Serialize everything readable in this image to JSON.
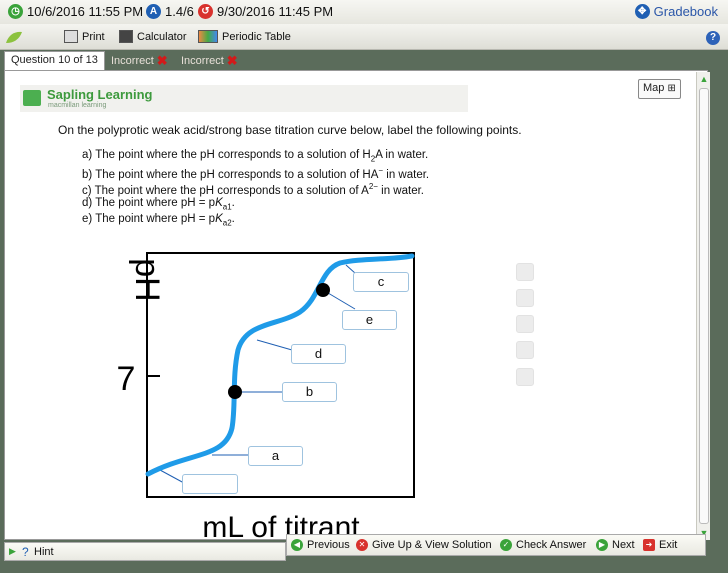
{
  "topbar": {
    "due_date": "10/6/2016 11:55 PM",
    "score": "1.4/6",
    "submitted": "9/30/2016 11:45 PM",
    "gradebook": "Gradebook"
  },
  "toolbar": {
    "print": "Print",
    "calculator": "Calculator",
    "periodic_table": "Periodic Table",
    "help": "?"
  },
  "tabs": {
    "question": "Question 10 of 13",
    "status1": "Incorrect",
    "status2": "Incorrect"
  },
  "map": "Map",
  "logo": {
    "name": "Sapling Learning",
    "tagline": "macmillan learning"
  },
  "question": {
    "prompt": "On the polyprotic weak acid/strong base titration curve below, label the following points.",
    "items": [
      {
        "prefix": "a) The point where the pH corresponds to a solution of H",
        "sub": "2",
        "suffix": "A in water."
      },
      {
        "prefix": "b) The point where the pH corresponds to a solution of HA",
        "sup": "−",
        "suffix": " in water."
      },
      {
        "prefix": "c) The point where the pH corresponds to a solution of A",
        "sup": "2−",
        "suffix": " in water."
      },
      {
        "prefix": "d) The point where pH = p",
        "italic": "K",
        "sub": "a1",
        "suffix": "."
      },
      {
        "prefix": "e) The point where pH = p",
        "italic": "K",
        "sub": "a2",
        "suffix": "."
      }
    ]
  },
  "chart_data": {
    "type": "line",
    "xlabel": "mL of titrant",
    "ylabel": "pH",
    "y_tick": "7",
    "curve_color": "#1f9be8",
    "labels": [
      "c",
      "e",
      "d",
      "b",
      "a",
      ""
    ]
  },
  "footer": {
    "hint": "Hint",
    "previous": "Previous",
    "give_up": "Give Up & View Solution",
    "check": "Check Answer",
    "next": "Next",
    "exit": "Exit"
  }
}
